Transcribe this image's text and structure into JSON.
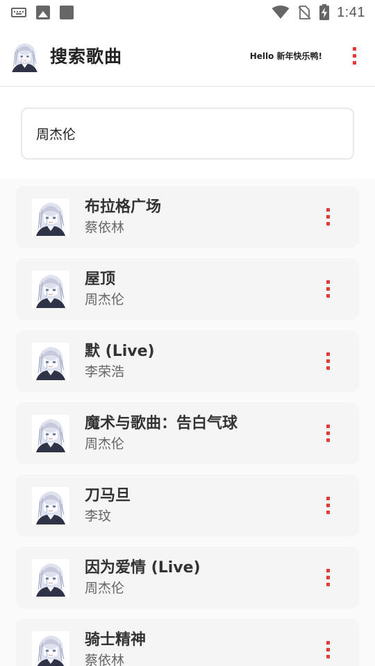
{
  "status_bar": {
    "time": "1:41",
    "left_icons": [
      "keyboard-icon",
      "image-icon",
      "square-icon"
    ],
    "right_icons": [
      "wifi-icon",
      "no-sim-icon",
      "battery-charging-icon"
    ]
  },
  "header": {
    "title": "搜索歌曲",
    "greeting": "Hello 新年快乐鸭!",
    "menu_icon": "more-vertical-icon"
  },
  "search": {
    "value": "周杰伦"
  },
  "songs": [
    {
      "title": "布拉格广场",
      "artist": "蔡依林"
    },
    {
      "title": "屋顶",
      "artist": "周杰伦"
    },
    {
      "title": "默 (Live)",
      "artist": "李荣浩"
    },
    {
      "title": "魔术与歌曲：告白气球",
      "artist": "周杰伦"
    },
    {
      "title": "刀马旦",
      "artist": "李玟"
    },
    {
      "title": "因为爱情 (Live)",
      "artist": "周杰伦"
    },
    {
      "title": "骑士精神",
      "artist": "蔡依林"
    }
  ],
  "colors": {
    "accent": "#e53935",
    "card_bg": "#f5f5f5",
    "list_bg": "#fafafa"
  }
}
